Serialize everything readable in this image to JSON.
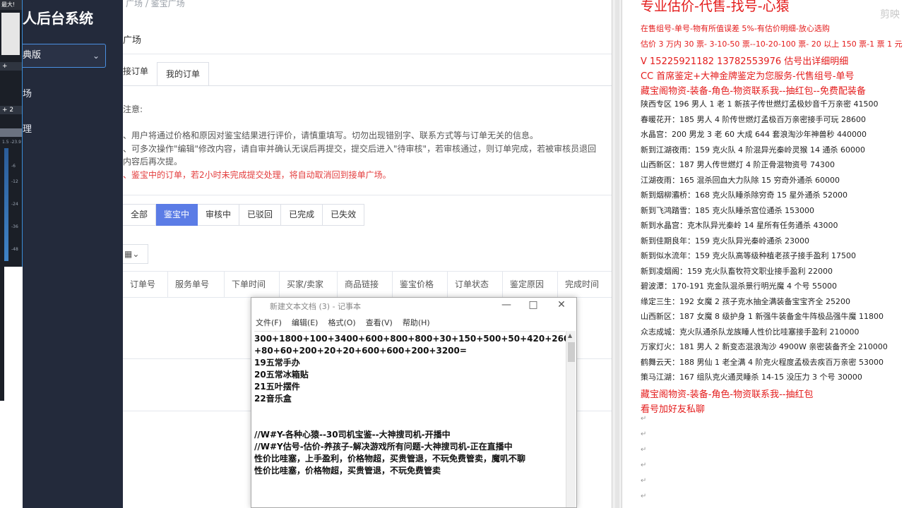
{
  "mixer": {
    "label": "最大!",
    "rows": [
      "+",
      "+ 2",
      "",
      "1.5 -23.9"
    ],
    "scale": [
      "-6",
      "-12",
      "-24",
      "-36",
      "-48"
    ]
  },
  "sidebar": {
    "title": "人后台系统",
    "version": "典版",
    "nav1": "场",
    "nav2": "理"
  },
  "main": {
    "breadcrumb": "广场 / 鉴宝广场",
    "page_title": "广场",
    "tab_accept": "接订单",
    "tab_mine": "我的订单",
    "note_title": "注意:",
    "notes": [
      "、用户将通过价格和原因对鉴宝结果进行评价，请慎重填写。切勿出现错别字、联系方式等与订单无关的信息。",
      "、可多次操作\"编辑\"修改内容，请自审并确认无误后再提交，提交后进入\"待审核\"，若审核通过，则订单完成，若被审核员退回",
      "内容后再次提。",
      "、鉴宝中的订单，若2小时未完成提交处理，将自动取消回到接单广场。"
    ],
    "filters": [
      "全部",
      "鉴宝中",
      "审核中",
      "已驳回",
      "已完成",
      "已失效"
    ],
    "columns_icon": "grid-icon",
    "table_headers": [
      "订单号",
      "服务单号",
      "下单时间",
      "买家/卖家",
      "商品链接",
      "鉴宝价格",
      "订单状态",
      "鉴定原因",
      "完成时间"
    ]
  },
  "notepad": {
    "title": "新建文本文档 (3) - 记事本",
    "menu": [
      "文件(F)",
      "编辑(E)",
      "格式(O)",
      "查看(V)",
      "帮助(H)"
    ],
    "lines": [
      "300+1800+100+3400+600+800+800+30+150+500+50+420+260",
      "+80+60+200+20+20+600+600+200+3200=",
      "19五常手办",
      "20五常冰箱贴",
      "21五叶摆件",
      "22音乐盒",
      "",
      "",
      "//W#Y-各种心猿--30司机宝鉴--大神搜司机-开播中",
      "//W#Y估号-估价-养孩子-解决游戏所有问题-大神搜司机-正在直播中",
      "性价比哇塞，上手盈利，价格物超，买贵管退，不玩免费管卖，魔叽不聊",
      "性价比哇塞，价格物超，买贵管退，不玩免费管卖"
    ]
  },
  "doc": {
    "headline": "专业估价-代售-找号-心猿",
    "watermark": "剪映",
    "lines": [
      {
        "text": "在售组号-单号-物有所值误差 5%-有估价明细-放心选购",
        "color": "red"
      },
      {
        "text": "估价 3 万内 30 票- 3-10-50 票--10-20-100 票- 20 以上 150 票-1 票 1 元",
        "color": "red"
      },
      {
        "text": "V 15225921182    13782553976    估号出详细明细",
        "color": "red",
        "big": true
      },
      {
        "text": "CC 首席鉴定+大神金牌鉴定为您服务-代售组号-单号",
        "color": "red",
        "big": true
      },
      {
        "text": "藏宝阁物资-装备-角色-物资联系我--抽红包--免费配装备",
        "color": "red",
        "big": true
      },
      {
        "text": "陕西专区 196 男人 1 老 1 新孩子传世燃灯孟极妙音千万亲密 41500",
        "color": "black"
      },
      {
        "text": "春暖花开：185 男人 4 阶传世燃灯孟极百万亲密接手可玩 28600",
        "color": "black"
      },
      {
        "text": "水晶宫：200 男龙 3 老 60 大成 644 套浪淘沙年神兽秒 440000",
        "color": "black"
      },
      {
        "text": "新到江湖夜雨：159 克火队 4 阶混异光秦岭灵猴 14 通杀 60000",
        "color": "black"
      },
      {
        "text": "山西新区：187 男人传世燃灯 4 阶正骨混物资号 74300",
        "color": "black"
      },
      {
        "text": "江湖夜雨：165 混杀回血大力队除 15 穷奇外通杀 60000",
        "color": "black"
      },
      {
        "text": "新到烟柳灞桥：168 克火队睡杀除穷奇 15 星外通杀 52000",
        "color": "black"
      },
      {
        "text": "新到飞鸿踏雪：185 克火队睡杀宫位通杀 153000",
        "color": "black"
      },
      {
        "text": "新到水晶宫：克木队异光秦岭 14 星所有任务通杀 43000",
        "color": "black"
      },
      {
        "text": "新到佳期良年：159 克火队异光秦岭通杀 23000",
        "color": "black"
      },
      {
        "text": "新到似水流年：159 克火队高等级种植老孩子接手盈利 17500",
        "color": "black"
      },
      {
        "text": "新到凌烟阁：159 克火队畜牧符文职业接手盈利 22000",
        "color": "black"
      },
      {
        "text": "碧波潭：170-191 克金队混杀景行明光魔 4 个号 55000",
        "color": "black"
      },
      {
        "text": "缘定三生：192 女魔 2 孩子克水抽全满装备宝宝齐全 25200",
        "color": "black"
      },
      {
        "text": "山西新区：187 女魔 8 级护身 1 新强牛装备金牛阵极品强牛魔 11800",
        "color": "black"
      },
      {
        "text": "众志成城：克火队通杀队龙族睡人性价比哇塞接手盈利 210000",
        "color": "black"
      },
      {
        "text": "万家灯火：181 男人 2 新变态混浪淘沙 4900W 亲密装备齐全 210000",
        "color": "black"
      },
      {
        "text": "鹤舞云天：188 男仙 1 老全满 4 阶克火程度孟极去疾百万亲密 53000",
        "color": "black"
      },
      {
        "text": "策马江湖：167 组队克火通灵睡杀 14-15 没压力 3 个号 30000",
        "color": "black"
      },
      {
        "text": "藏宝阁物资-装备-角色-物资联系我--抽红包",
        "color": "red",
        "big": true
      },
      {
        "text": "看号加好友私聊",
        "color": "red",
        "big": true
      }
    ],
    "para_marks": [
      "↵",
      "↵",
      "↵",
      "↵",
      "↵",
      "↵"
    ]
  }
}
